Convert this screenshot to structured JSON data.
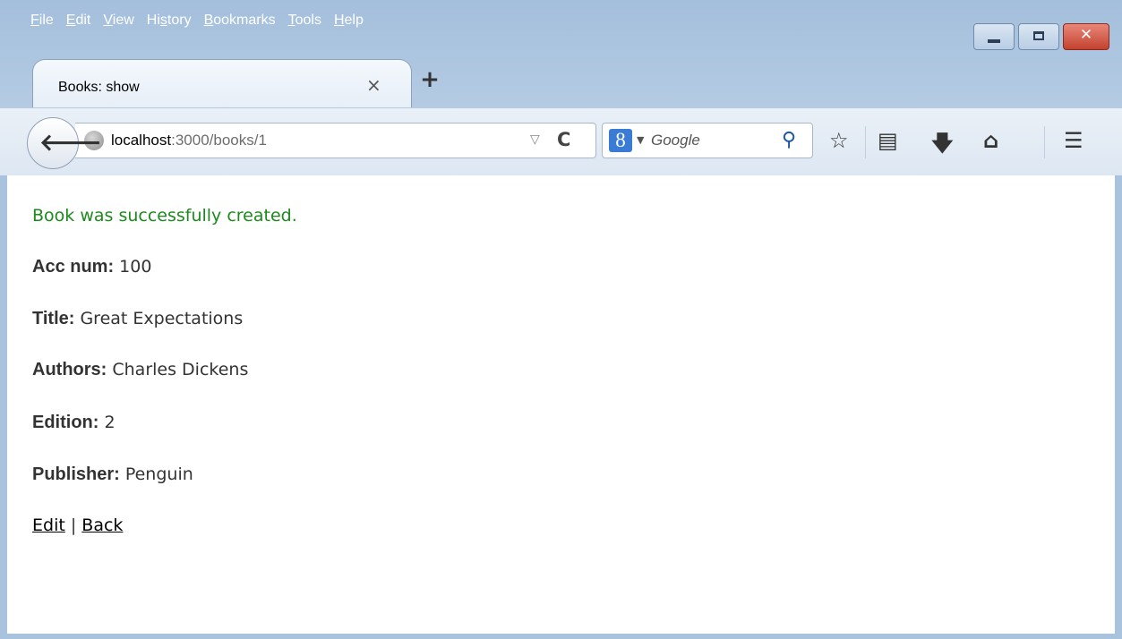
{
  "menu": [
    {
      "first": "F",
      "rest": "ile"
    },
    {
      "first": "E",
      "rest": "dit"
    },
    {
      "first": "V",
      "rest": "iew"
    },
    {
      "pre": "Hi",
      "first": "s",
      "rest": "tory"
    },
    {
      "first": "B",
      "rest": "ookmarks"
    },
    {
      "first": "T",
      "rest": "ools"
    },
    {
      "first": "H",
      "rest": "elp"
    }
  ],
  "window_controls": {
    "minimize": "minimize-icon",
    "maximize": "maximize-icon",
    "close": "✕"
  },
  "tab": {
    "title": "Books: show",
    "close": "×",
    "new_tab": "+"
  },
  "url": {
    "host": "localhost",
    "path": ":3000/books/1"
  },
  "search": {
    "engine_badge": "8",
    "placeholder": "Google"
  },
  "page": {
    "notice": "Book was successfully created.",
    "fields": [
      {
        "label": "Acc num:",
        "value": " 100"
      },
      {
        "label": "Title:",
        "value": " Great Expectations"
      },
      {
        "label": "Authors:",
        "value": " Charles Dickens"
      },
      {
        "label": "Edition:",
        "value": " 2"
      },
      {
        "label": "Publisher:",
        "value": " Penguin"
      }
    ],
    "links": {
      "edit": "Edit",
      "separator": " | ",
      "back": "Back"
    }
  },
  "colors": {
    "notice": "#1c8a1c",
    "chrome": "#a9c2dd"
  }
}
